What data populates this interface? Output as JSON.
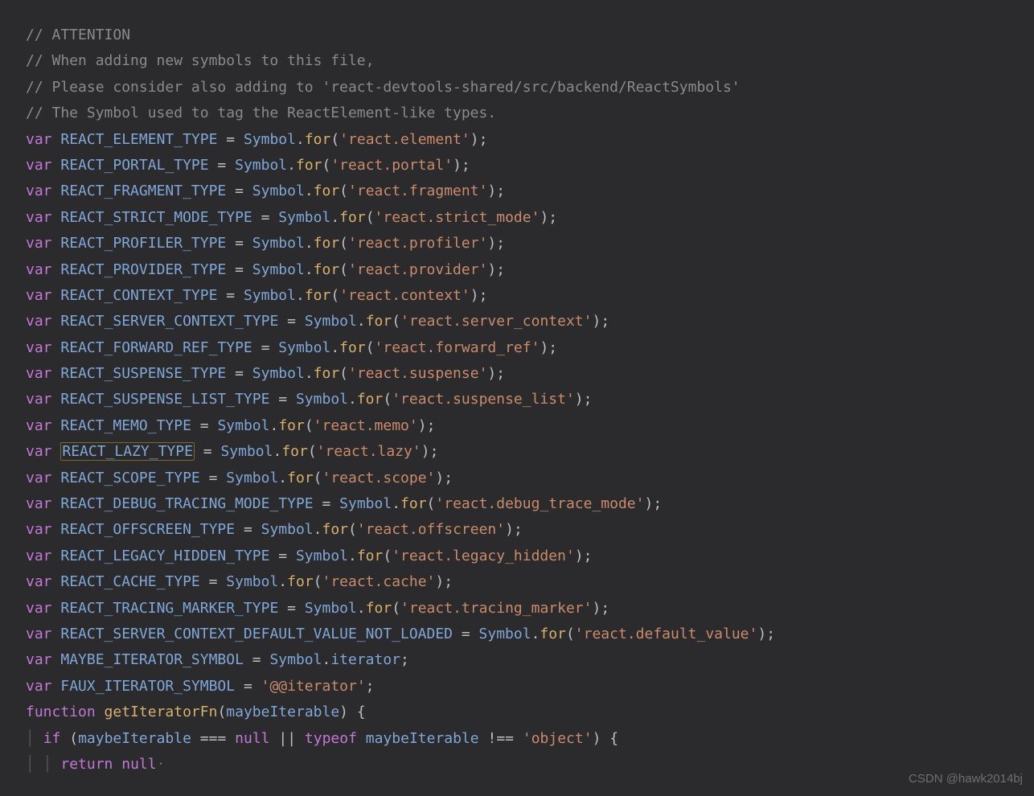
{
  "comments": {
    "c1": "// ATTENTION",
    "c2": "// When adding new symbols to this file,",
    "c3": "// Please consider also adding to 'react-devtools-shared/src/backend/ReactSymbols'",
    "c4": "// The Symbol used to tag the ReactElement-like types."
  },
  "kw": {
    "var": "var",
    "function": "function",
    "if": "if",
    "return": "return",
    "typeof": "typeof",
    "null": "null"
  },
  "sym": {
    "Symbol": "Symbol",
    "for": "for",
    "iterator": "iterator"
  },
  "decls": {
    "d1": {
      "name": "REACT_ELEMENT_TYPE",
      "str": "'react.element'"
    },
    "d2": {
      "name": "REACT_PORTAL_TYPE",
      "str": "'react.portal'"
    },
    "d3": {
      "name": "REACT_FRAGMENT_TYPE",
      "str": "'react.fragment'"
    },
    "d4": {
      "name": "REACT_STRICT_MODE_TYPE",
      "str": "'react.strict_mode'"
    },
    "d5": {
      "name": "REACT_PROFILER_TYPE",
      "str": "'react.profiler'"
    },
    "d6": {
      "name": "REACT_PROVIDER_TYPE",
      "str": "'react.provider'"
    },
    "d7": {
      "name": "REACT_CONTEXT_TYPE",
      "str": "'react.context'"
    },
    "d8": {
      "name": "REACT_SERVER_CONTEXT_TYPE",
      "str": "'react.server_context'"
    },
    "d9": {
      "name": "REACT_FORWARD_REF_TYPE",
      "str": "'react.forward_ref'"
    },
    "d10": {
      "name": "REACT_SUSPENSE_TYPE",
      "str": "'react.suspense'"
    },
    "d11": {
      "name": "REACT_SUSPENSE_LIST_TYPE",
      "str": "'react.suspense_list'"
    },
    "d12": {
      "name": "REACT_MEMO_TYPE",
      "str": "'react.memo'"
    },
    "d13": {
      "name": "REACT_LAZY_TYPE",
      "str": "'react.lazy'"
    },
    "d14": {
      "name": "REACT_SCOPE_TYPE",
      "str": "'react.scope'"
    },
    "d15": {
      "name": "REACT_DEBUG_TRACING_MODE_TYPE",
      "str": "'react.debug_trace_mode'"
    },
    "d16": {
      "name": "REACT_OFFSCREEN_TYPE",
      "str": "'react.offscreen'"
    },
    "d17": {
      "name": "REACT_LEGACY_HIDDEN_TYPE",
      "str": "'react.legacy_hidden'"
    },
    "d18": {
      "name": "REACT_CACHE_TYPE",
      "str": "'react.cache'"
    },
    "d19": {
      "name": "REACT_TRACING_MARKER_TYPE",
      "str": "'react.tracing_marker'"
    },
    "d20": {
      "name": "REACT_SERVER_CONTEXT_DEFAULT_VALUE_NOT_LOADED",
      "str": "'react.default_value'"
    }
  },
  "iterDecl": {
    "name": "MAYBE_ITERATOR_SYMBOL"
  },
  "fauxDecl": {
    "name": "FAUX_ITERATOR_SYMBOL",
    "str": "'@@iterator'"
  },
  "fn": {
    "name": "getIteratorFn",
    "param": "maybeIterable",
    "objStr": "'object'"
  },
  "punct": {
    "eq": " = ",
    "dot": ".",
    "lp": "(",
    "rp": ")",
    "semi": ";",
    "lb": " {",
    "rb": "}",
    "excleq": "!==",
    "tripleeq": "===",
    "or": "||",
    "sp": " "
  },
  "watermark": "CSDN @hawk2014bj"
}
